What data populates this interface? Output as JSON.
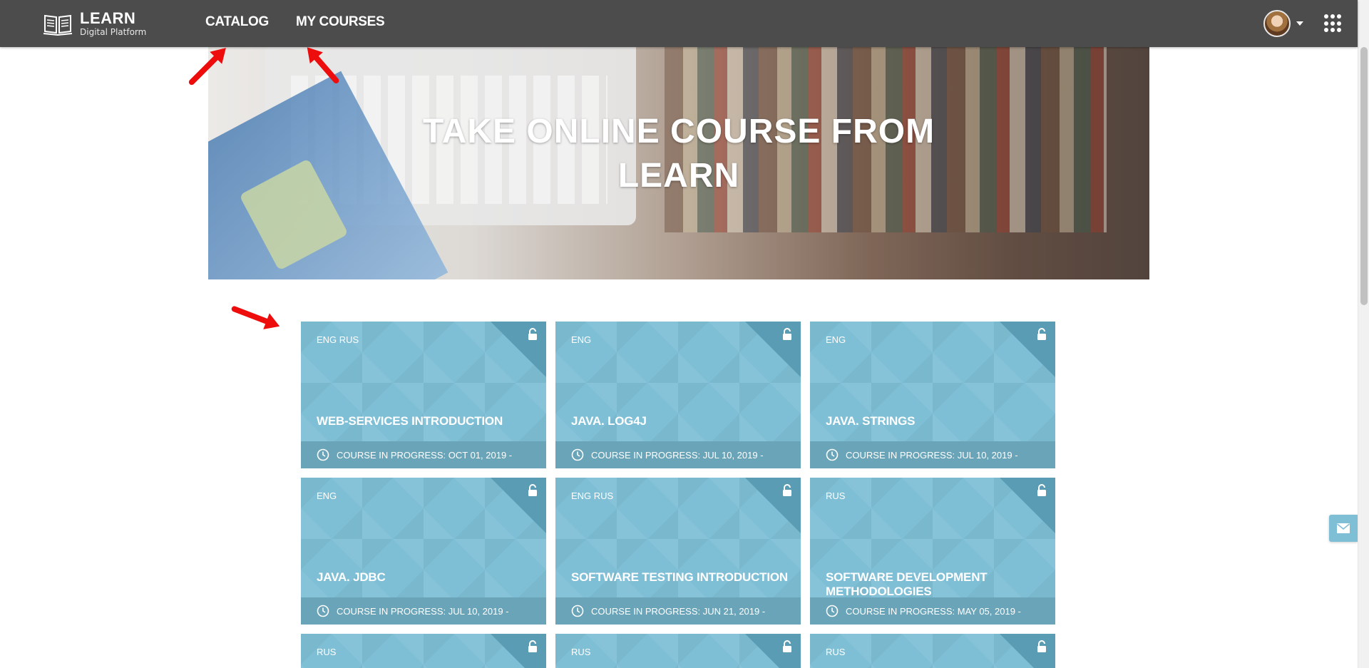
{
  "brand": {
    "title": "LEARN",
    "subtitle": "Digital Platform",
    "icon": "book-icon"
  },
  "nav": {
    "catalog": "CATALOG",
    "my_courses": "MY COURSES"
  },
  "header": {
    "avatar_icon": "user-avatar",
    "apps_icon": "apps-grid-icon"
  },
  "hero": {
    "line1": "TAKE ONLINE COURSE FROM",
    "line2": "LEARN"
  },
  "courses": [
    {
      "lang": "ENG RUS",
      "title": "WEB-SERVICES INTRODUCTION",
      "status": "COURSE IN PROGRESS: OCT 01, 2019 -"
    },
    {
      "lang": "ENG",
      "title": "JAVA. LOG4J",
      "status": "COURSE IN PROGRESS: JUL 10, 2019 -"
    },
    {
      "lang": "ENG",
      "title": "JAVA. STRINGS",
      "status": "COURSE IN PROGRESS: JUL 10, 2019 -"
    },
    {
      "lang": "ENG",
      "title": "JAVA. JDBC",
      "status": "COURSE IN PROGRESS: JUL 10, 2019 -"
    },
    {
      "lang": "ENG RUS",
      "title": "SOFTWARE TESTING INTRODUCTION",
      "status": "COURSE IN PROGRESS: JUN 21, 2019 -"
    },
    {
      "lang": "RUS",
      "title": "SOFTWARE DEVELOPMENT METHODOLOGIES",
      "status": "COURSE IN PROGRESS: MAY 05, 2019 -"
    },
    {
      "lang": "RUS"
    },
    {
      "lang": "RUS"
    },
    {
      "lang": "RUS"
    }
  ],
  "colors": {
    "topbar": "#4c4c4c",
    "card": "#7fbfd6",
    "card_band": "#6aa4b8",
    "arrow": "#ee0d0d"
  }
}
